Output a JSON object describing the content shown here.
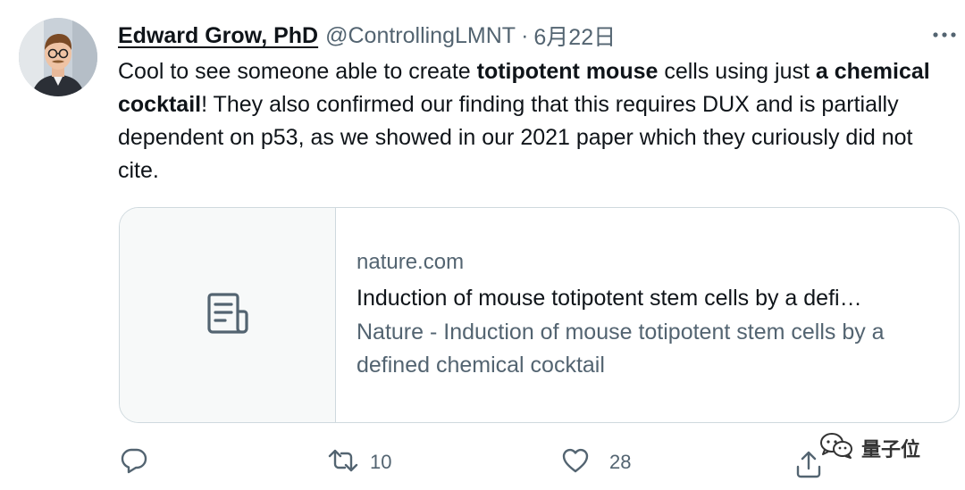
{
  "tweet": {
    "author_name": "Edward Grow, PhD",
    "handle": "@ControllingLMNT",
    "separator": "·",
    "date": "6月22日",
    "text_parts": {
      "p1": "Cool to see someone able to create ",
      "b1": "totipotent mouse",
      "p2": " cells using just ",
      "b2": "a chemical cocktail",
      "p3": "! They also confirmed our finding that this requires DUX and is partially dependent on p53, as we showed in our 2021 paper which they curiously did not cite."
    }
  },
  "card": {
    "domain": "nature.com",
    "title": "Induction of mouse totipotent stem cells by a defi…",
    "description": "Nature - Induction of mouse totipotent stem cells by a defined chemical cocktail",
    "thumb_icon": "article-icon"
  },
  "actions": {
    "reply": {
      "icon": "reply-icon",
      "count": ""
    },
    "retweet": {
      "icon": "retweet-icon",
      "count": "10"
    },
    "like": {
      "icon": "heart-icon",
      "count": "28"
    },
    "share": {
      "icon": "share-icon",
      "count": ""
    }
  },
  "watermark": {
    "icon": "wechat-icon",
    "label": "量子位"
  },
  "colors": {
    "text_primary": "#0f1419",
    "text_secondary": "#536471",
    "border": "#cfd9de",
    "card_thumb_bg": "#f7f9f9"
  }
}
